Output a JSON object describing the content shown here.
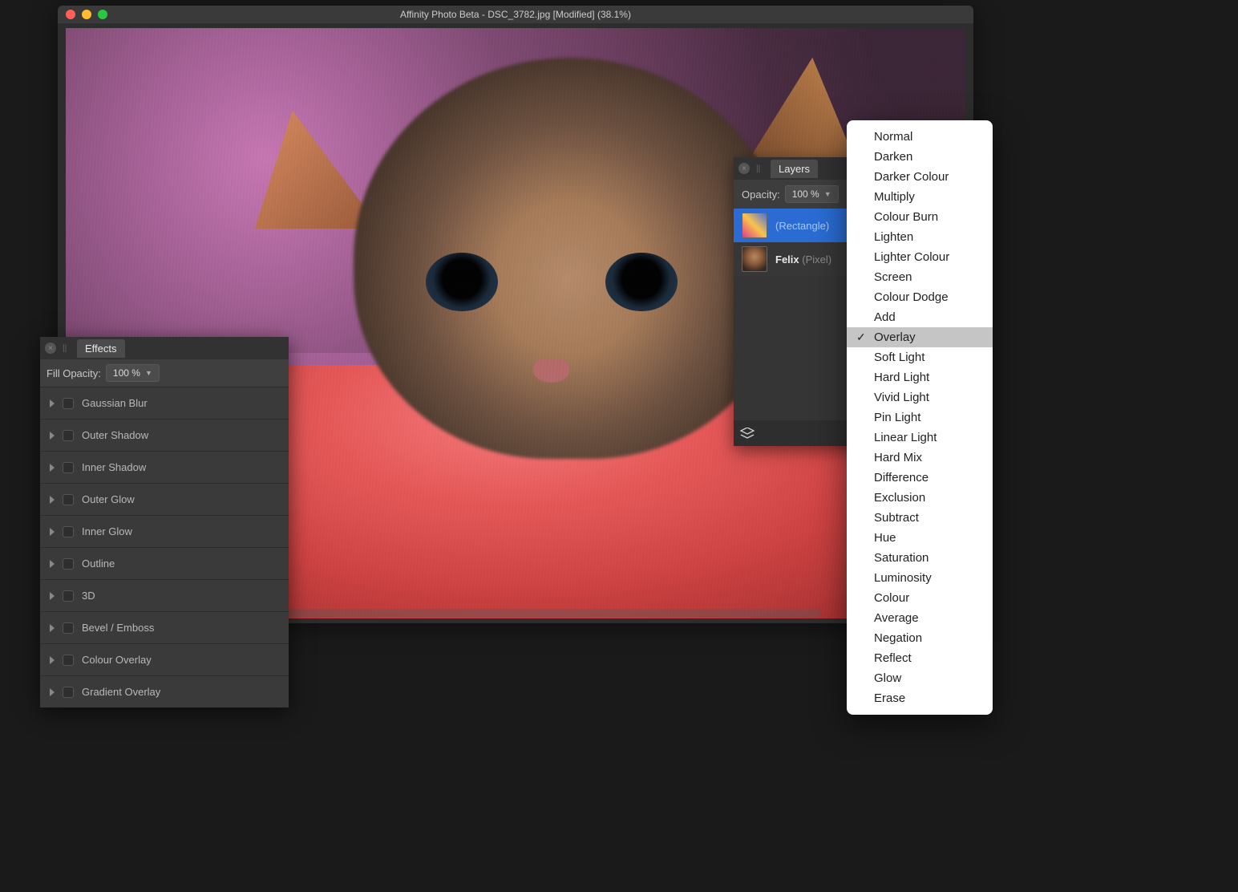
{
  "window": {
    "title": "Affinity Photo Beta - DSC_3782.jpg [Modified] (38.1%)"
  },
  "effects_panel": {
    "tab_label": "Effects",
    "fill_opacity_label": "Fill Opacity:",
    "fill_opacity_value": "100 %",
    "items": [
      "Gaussian Blur",
      "Outer Shadow",
      "Inner Shadow",
      "Outer Glow",
      "Inner Glow",
      "Outline",
      "3D",
      "Bevel / Emboss",
      "Colour Overlay",
      "Gradient Overlay"
    ]
  },
  "layers_panel": {
    "tab_label": "Layers",
    "opacity_label": "Opacity:",
    "opacity_value": "100 %",
    "layers": [
      {
        "name": "",
        "type": "(Rectangle)",
        "selected": true,
        "thumb": "gradient"
      },
      {
        "name": "Felix",
        "type": "(Pixel)",
        "selected": false,
        "thumb": "cat"
      }
    ]
  },
  "blend_menu": {
    "items": [
      "Normal",
      "Darken",
      "Darker Colour",
      "Multiply",
      "Colour Burn",
      "Lighten",
      "Lighter Colour",
      "Screen",
      "Colour Dodge",
      "Add",
      "Overlay",
      "Soft Light",
      "Hard Light",
      "Vivid Light",
      "Pin Light",
      "Linear Light",
      "Hard Mix",
      "Difference",
      "Exclusion",
      "Subtract",
      "Hue",
      "Saturation",
      "Luminosity",
      "Colour",
      "Average",
      "Negation",
      "Reflect",
      "Glow",
      "Erase"
    ],
    "selected": "Overlay"
  }
}
